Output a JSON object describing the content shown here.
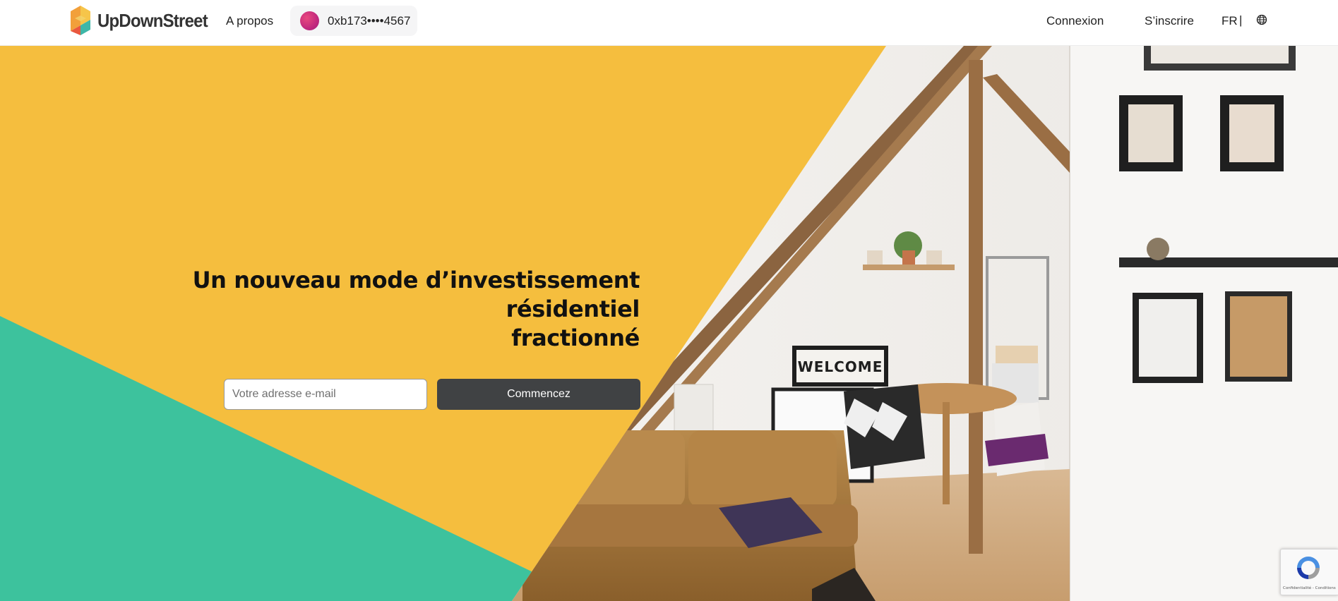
{
  "header": {
    "brand": "UpDownStreet",
    "nav_about": "A propos",
    "wallet_address": "0xb173••••4567",
    "login": "Connexion",
    "signup": "S’inscrire",
    "language": "FR",
    "separator": "|"
  },
  "hero": {
    "title_line1": "Un nouveau mode d’investissement résidentiel",
    "title_line2": "fractionné",
    "email_placeholder": "Votre adresse e-mail",
    "cta": "Commencez",
    "image_sign": "WELCOME"
  },
  "recaptcha": {
    "text": "Confidentialité - Conditions"
  },
  "colors": {
    "yellow": "#f5be3e",
    "green": "#3dc29d",
    "button": "#404244",
    "wallet_avatar": "#d8327f"
  },
  "icons": [
    "logo-icon",
    "wallet-avatar-icon",
    "globe-icon",
    "recaptcha-icon"
  ]
}
